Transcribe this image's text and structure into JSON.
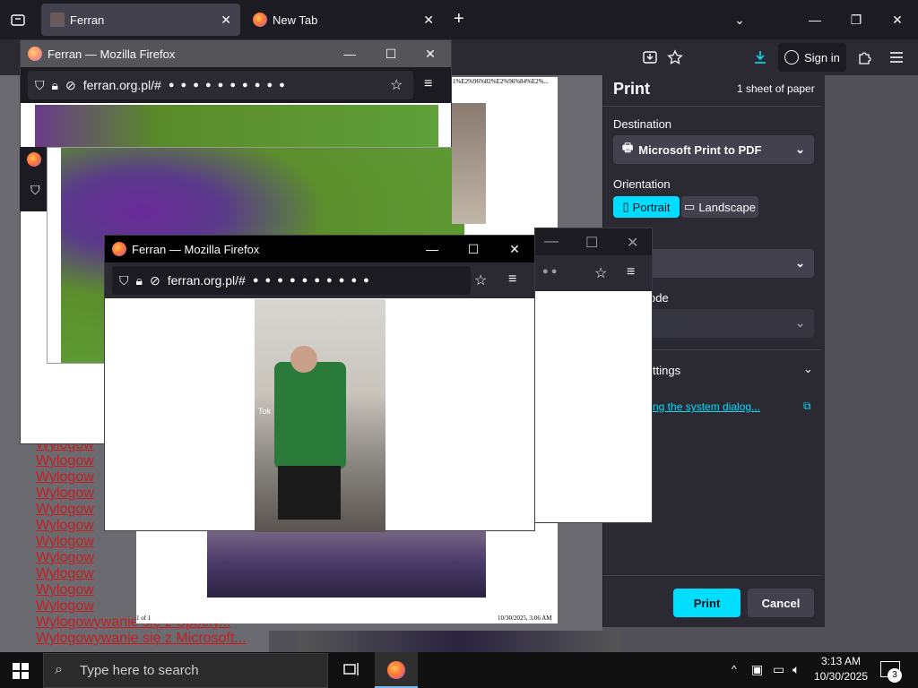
{
  "browser": {
    "tabs": [
      {
        "label": "Ferran"
      },
      {
        "label": "New Tab"
      }
    ],
    "toolbar": {
      "sign_in": "Sign in"
    }
  },
  "print_preview": {
    "header_text": "1%E2%96%82%E2%96%84%E2%...",
    "footer_left": "1 of 1",
    "footer_right": "10/30/2025, 3:06 AM"
  },
  "print_panel": {
    "title": "Print",
    "sheets": "1 sheet of paper",
    "destination_label": "Destination",
    "destination_value": "Microsoft Print to PDF",
    "orientation_label": "Orientation",
    "portrait": "Portrait",
    "landscape": "Landscape",
    "color_mode_label_partial": "ode",
    "more_settings_partial": "ttings",
    "system_dialog_partial": "ng the system dialog...",
    "print_button": "Print",
    "cancel_button": "Cancel"
  },
  "logout_lines": [
    "Wylogow",
    "Wylogow",
    "Wylogow",
    "Wylogow",
    "Wylogow",
    "Wylogow",
    "Wylogow",
    "Wylogow",
    "Wylogow",
    "Wylogow",
    "Wylogow",
    "Wylogowywanie się z Spotify...",
    "Wylogowywanie się z Microsoft..."
  ],
  "popups": {
    "back_window_title": "Ferran — Mozilla Firefox",
    "front_window_title": "Ferran — Mozilla Firefox",
    "url_text": "ferran.org.pl/#",
    "tiktok_watermark": "Tok"
  },
  "taskbar": {
    "search_placeholder": "Type here to search",
    "time": "3:13 AM",
    "date": "10/30/2025",
    "notification_count": "3"
  },
  "colors": {
    "accent": "#00ddff",
    "logout_red": "#c42020",
    "firefox_dark": "#1c1b22"
  }
}
